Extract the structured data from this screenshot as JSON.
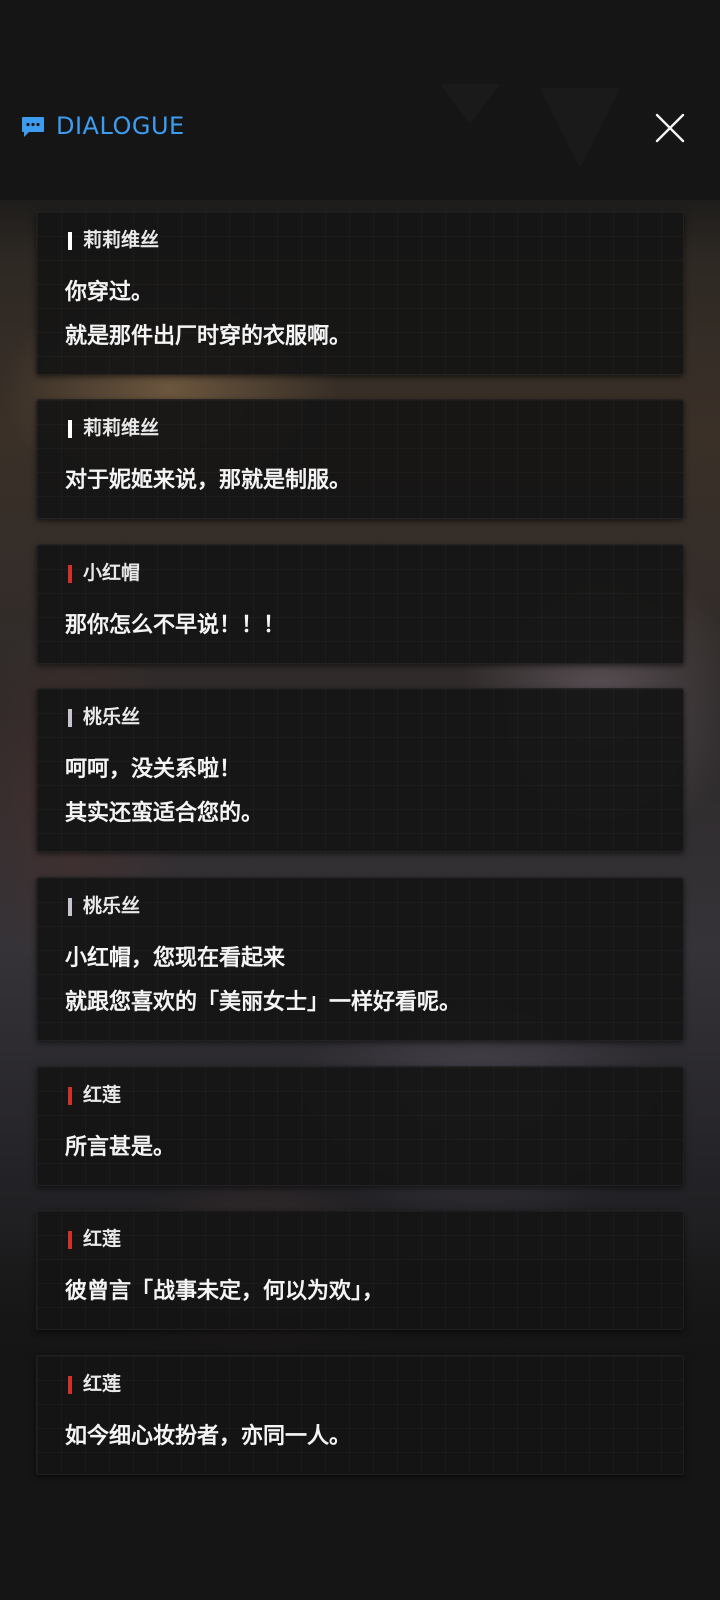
{
  "header": {
    "title": "DIALOGUE",
    "icon": "chat-bubble-icon",
    "accent_color": "#3d9cf0",
    "close_icon": "close-icon"
  },
  "speaker_colors": {
    "lilith": "#ffffff",
    "red_hood": "#d0322b",
    "dorothy": "#c8c3cc",
    "guren": "#d0322b"
  },
  "entries": [
    {
      "speaker": "莉莉维丝",
      "lines": [
        "你穿过。",
        "就是那件出厂时穿的衣服啊。"
      ]
    },
    {
      "speaker": "莉莉维丝",
      "lines": [
        "对于妮姬来说，那就是制服。"
      ]
    },
    {
      "speaker": "小红帽",
      "lines": [
        "那你怎么不早说！！！"
      ]
    },
    {
      "speaker": "桃乐丝",
      "lines": [
        "呵呵，没关系啦！",
        "其实还蛮适合您的。"
      ]
    },
    {
      "speaker": "桃乐丝",
      "lines": [
        "小红帽，您现在看起来",
        "就跟您喜欢的「美丽女士」一样好看呢。"
      ]
    },
    {
      "speaker": "红莲",
      "lines": [
        "所言甚是。"
      ]
    },
    {
      "speaker": "红莲",
      "lines": [
        "彼曾言「战事未定，何以为欢」，"
      ]
    },
    {
      "speaker": "红莲",
      "lines": [
        "如今细心妆扮者，亦同一人。"
      ]
    }
  ]
}
